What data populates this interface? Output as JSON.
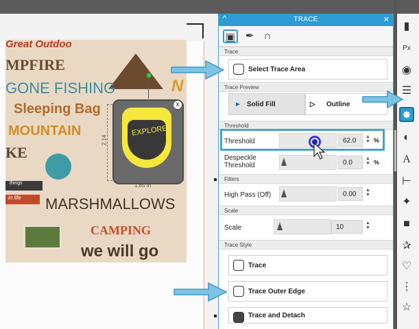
{
  "panel": {
    "title": "TRACE",
    "sections": {
      "trace": "Trace",
      "trace_preview": "Trace Preview",
      "threshold": "Threshold",
      "filters": "Filters",
      "scale": "Scale",
      "trace_style": "Trace Style"
    },
    "select_trace_area": "Select Trace Area",
    "preview": {
      "solid_fill": "Solid Fill",
      "outline": "Outline"
    },
    "threshold_row": {
      "label": "Threshold",
      "value": "62.0",
      "unit": "%"
    },
    "despeckle_row": {
      "label": "Despeckle\nThreshold",
      "value": "0.0",
      "unit": "%"
    },
    "highpass_row": {
      "label": "High Pass (Off)",
      "value": "0.00"
    },
    "scale_row": {
      "label": "Scale",
      "value": "10"
    },
    "styles": {
      "trace": "Trace",
      "trace_outer_edge": "Trace Outer Edge",
      "trace_and_detach": "Trace and Detach"
    }
  },
  "artwork": {
    "words": {
      "top": "Great Outdoo",
      "campfire": "MPFIRE",
      "fishing": "GONE FISHING",
      "bags": "Sleeping Bag",
      "mountains": "MOUNTAIN",
      "ke": "KE",
      "marsh": "MARSHMALLOWS",
      "camping": "CAMPING",
      "wewillgo": "we will go",
      "no": "N",
      "tag_red": "in life",
      "tag_dark": "things"
    },
    "badge_text": "EXPLORE",
    "close_glyph": "x",
    "dim_width": "1.85 in",
    "dim_height": "2.14"
  },
  "colors": {
    "accent": "#2d9bd4",
    "highlight": "#4aa3c2",
    "badge_yellow": "#f5e73b"
  }
}
